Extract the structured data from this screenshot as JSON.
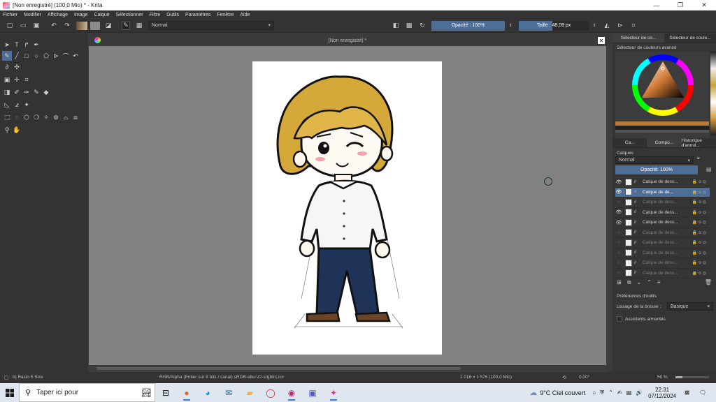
{
  "window": {
    "title": "[Non enregistré]  (100,0 Mio)  * - Krita",
    "minimize": "—",
    "maximize": "❐",
    "close": "✕"
  },
  "menu": [
    "Fichier",
    "Modifier",
    "Affichage",
    "Image",
    "Calque",
    "Sélectionner",
    "Filtre",
    "Outils",
    "Paramètres",
    "Fenêtre",
    "Aide"
  ],
  "toolbar": {
    "blend_mode": "Normal",
    "opacity_label": "Opacité : 100%",
    "size_label": "Taille :  48,09 px"
  },
  "document": {
    "tab_title": "[Non enregistré]  *",
    "close": "✕"
  },
  "docker": {
    "top_tabs": [
      "Sélecteur de co...",
      "Sélecteur de coule..."
    ],
    "color_selector_title": "Sélecteur de couleurs avancé",
    "mid_tabs": [
      "Ca...",
      "Compo...",
      "Historique d'annul..."
    ],
    "layers_title": "Calques",
    "layers_blend": "Normal",
    "layers_opacity": "Opacité:  100%",
    "layers": [
      {
        "name": "Calque de dess...",
        "visible": true,
        "selected": false,
        "dim": false
      },
      {
        "name": "Calque de de...",
        "visible": true,
        "selected": true,
        "dim": false
      },
      {
        "name": "Calque de dess...",
        "visible": false,
        "selected": false,
        "dim": true
      },
      {
        "name": "Calque de dess...",
        "visible": true,
        "selected": false,
        "dim": false
      },
      {
        "name": "Calque de dess...",
        "visible": true,
        "selected": false,
        "dim": false
      },
      {
        "name": "Calque de dess...",
        "visible": false,
        "selected": false,
        "dim": true
      },
      {
        "name": "Calque de dess...",
        "visible": false,
        "selected": false,
        "dim": true
      },
      {
        "name": "Calque de dess...",
        "visible": false,
        "selected": false,
        "dim": true
      },
      {
        "name": "Calque de dess...",
        "visible": false,
        "selected": false,
        "dim": true
      },
      {
        "name": "Calque de dess...",
        "visible": false,
        "selected": false,
        "dim": true
      }
    ],
    "tool_prefs_title": "Préférences d'outils",
    "brush_smoothing_label": "Lissage de la brosse :",
    "brush_smoothing_value": "Basique",
    "snap_assistants": "Assistants aimantés"
  },
  "status": {
    "brush": "b) Basic-5 Size",
    "color_space": "RGB/Alpha (Entier sur 8 bits / canal)  sRGB-elle-V2-srgbtrc.icc",
    "dimensions": "1 016 x 1 576 (100,0 Mio)",
    "rotation": "0,00°",
    "zoom": "50 %"
  },
  "taskbar": {
    "search_placeholder": "Taper ici pour",
    "weather": "9°C  Ciel couvert",
    "time": "22:31",
    "date": "07/12/2024"
  },
  "colors": {
    "accent": "#4d6e96",
    "canvas_bg": "#828282",
    "ui_dark": "#333333"
  }
}
